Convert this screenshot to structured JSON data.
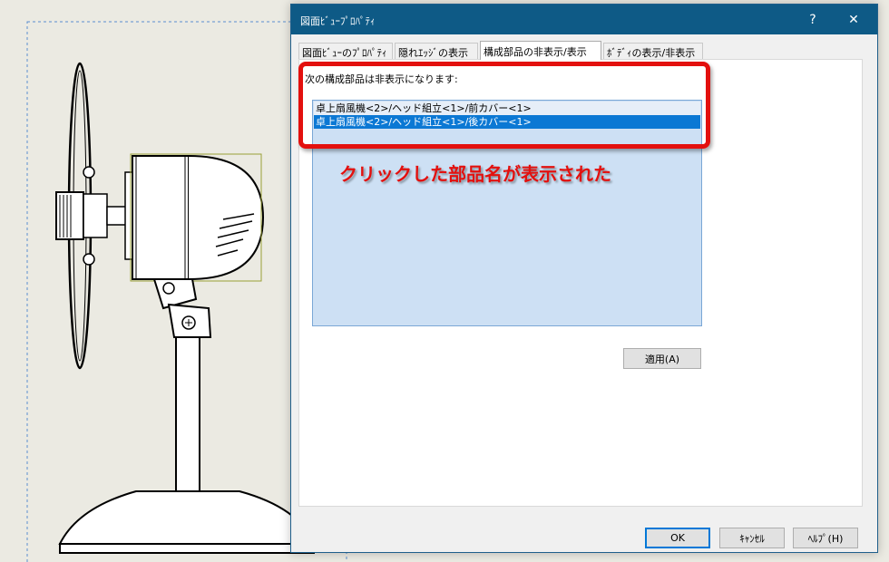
{
  "dialog": {
    "title": "図面ﾋﾞｭｰﾌﾟﾛﾊﾟﾃｨ",
    "help_glyph": "?",
    "close_glyph": "✕"
  },
  "tabs": [
    {
      "label": "図面ﾋﾞｭｰのﾌﾟﾛﾊﾟﾃｨ"
    },
    {
      "label": "隠れｴｯｼﾞの表示"
    },
    {
      "label": "構成部品の非表示/表示"
    },
    {
      "label": "ﾎﾞﾃﾞｨの表示/非表示"
    }
  ],
  "panel": {
    "label": "次の構成部品は非表示になります:",
    "list_items": [
      "卓上扇風機<2>/ヘッド組立<1>/前カバー<1>",
      "卓上扇風機<2>/ヘッド組立<1>/後カバー<1>"
    ],
    "apply_label": "適用(A)"
  },
  "annotation": {
    "callout": "クリックした部品名が表示された",
    "color": "#e3100e"
  },
  "buttons": {
    "ok": "OK",
    "cancel": "ｷｬﾝｾﾙ",
    "help": "ﾍﾙﾌﾟ(H)"
  },
  "colors": {
    "titlebar": "#0e5a86",
    "selection": "#0b78d4",
    "listbox_bg": "#cde0f4"
  }
}
